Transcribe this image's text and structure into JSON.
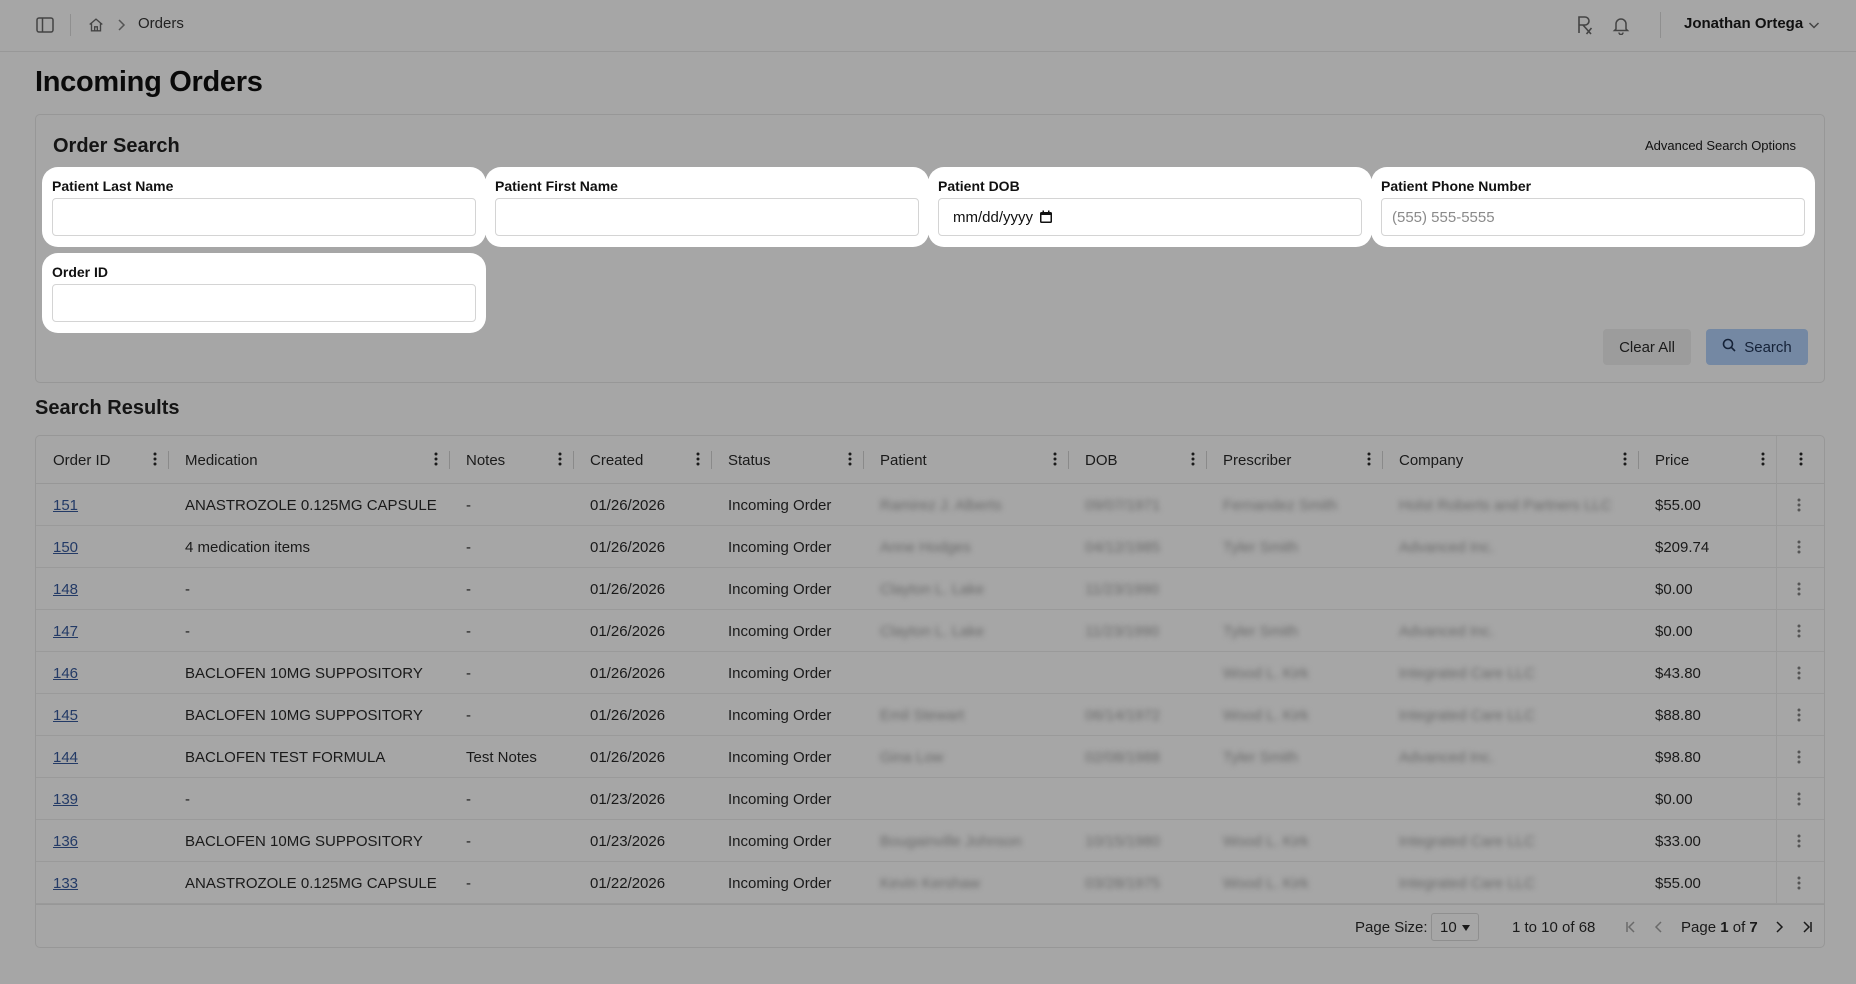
{
  "breadcrumb": {
    "current": "Orders"
  },
  "user": {
    "name": "Jonathan Ortega"
  },
  "page": {
    "title": "Incoming Orders"
  },
  "search": {
    "title": "Order Search",
    "advanced_link": "Advanced Search Options",
    "fields": {
      "last_name": {
        "label": "Patient Last Name",
        "value": "",
        "placeholder": ""
      },
      "first_name": {
        "label": "Patient First Name",
        "value": "",
        "placeholder": ""
      },
      "dob": {
        "label": "Patient DOB",
        "placeholder": "mm/dd/yyyy"
      },
      "phone": {
        "label": "Patient Phone Number",
        "placeholder": "(555) 555-5555"
      },
      "order_id": {
        "label": "Order ID",
        "value": "",
        "placeholder": ""
      }
    },
    "clear_label": "Clear All",
    "search_label": "Search"
  },
  "results": {
    "title": "Search Results",
    "columns": [
      "Order ID",
      "Medication",
      "Notes",
      "Created",
      "Status",
      "Patient",
      "DOB",
      "Prescriber",
      "Company",
      "Price"
    ],
    "rows": [
      {
        "id": "151",
        "medication": "ANASTROZOLE 0.125MG CAPSULE",
        "notes": "-",
        "created": "01/26/2026",
        "status": "Incoming Order",
        "patient": "Ramirez J. Alberts",
        "dob": "09/07/1971",
        "prescriber": "Fernandez Smith",
        "company": "Holst Roberts and Partners LLC",
        "price": "$55.00"
      },
      {
        "id": "150",
        "medication": "4 medication items",
        "notes": "-",
        "created": "01/26/2026",
        "status": "Incoming Order",
        "patient": "Anne Hodges",
        "dob": "04/12/1985",
        "prescriber": "Tyler Smith",
        "company": "Advanced Inc.",
        "price": "$209.74"
      },
      {
        "id": "148",
        "medication": "-",
        "notes": "-",
        "created": "01/26/2026",
        "status": "Incoming Order",
        "patient": "Clayton L. Lake",
        "dob": "11/23/1990",
        "prescriber": "",
        "company": "",
        "price": "$0.00"
      },
      {
        "id": "147",
        "medication": "-",
        "notes": "-",
        "created": "01/26/2026",
        "status": "Incoming Order",
        "patient": "Clayton L. Lake",
        "dob": "11/23/1990",
        "prescriber": "Tyler Smith",
        "company": "Advanced Inc.",
        "price": "$0.00"
      },
      {
        "id": "146",
        "medication": "BACLOFEN 10MG SUPPOSITORY",
        "notes": "-",
        "created": "01/26/2026",
        "status": "Incoming Order",
        "patient": "",
        "dob": "",
        "prescriber": "Wood L. Kirk",
        "company": "Integrated Care LLC",
        "price": "$43.80"
      },
      {
        "id": "145",
        "medication": "BACLOFEN 10MG SUPPOSITORY",
        "notes": "-",
        "created": "01/26/2026",
        "status": "Incoming Order",
        "patient": "Emil Stewart",
        "dob": "06/14/1972",
        "prescriber": "Wood L. Kirk",
        "company": "Integrated Care LLC",
        "price": "$88.80"
      },
      {
        "id": "144",
        "medication": "BACLOFEN TEST FORMULA",
        "notes": "Test Notes",
        "created": "01/26/2026",
        "status": "Incoming Order",
        "patient": "Gina Low",
        "dob": "02/08/1988",
        "prescriber": "Tyler Smith",
        "company": "Advanced Inc.",
        "price": "$98.80"
      },
      {
        "id": "139",
        "medication": "-",
        "notes": "-",
        "created": "01/23/2026",
        "status": "Incoming Order",
        "patient": "",
        "dob": "",
        "prescriber": "",
        "company": "",
        "price": "$0.00"
      },
      {
        "id": "136",
        "medication": "BACLOFEN 10MG SUPPOSITORY",
        "notes": "-",
        "created": "01/23/2026",
        "status": "Incoming Order",
        "patient": "Bougainville Johnson",
        "dob": "10/15/1980",
        "prescriber": "Wood L. Kirk",
        "company": "Integrated Care LLC",
        "price": "$33.00"
      },
      {
        "id": "133",
        "medication": "ANASTROZOLE 0.125MG CAPSULE",
        "notes": "-",
        "created": "01/22/2026",
        "status": "Incoming Order",
        "patient": "Kevin Kershaw",
        "dob": "03/28/1975",
        "prescriber": "Wood L. Kirk",
        "company": "Integrated Care LLC",
        "price": "$55.00"
      }
    ]
  },
  "pagination": {
    "page_size_label": "Page Size:",
    "page_size": "10",
    "range": "1 to 10 of 68",
    "page_prefix": "Page",
    "current_page": "1",
    "page_of": "of",
    "total_pages": "7"
  },
  "colors": {
    "accent": "#7488a3",
    "link": "#233a66",
    "overlay": "#a6a6a6"
  }
}
